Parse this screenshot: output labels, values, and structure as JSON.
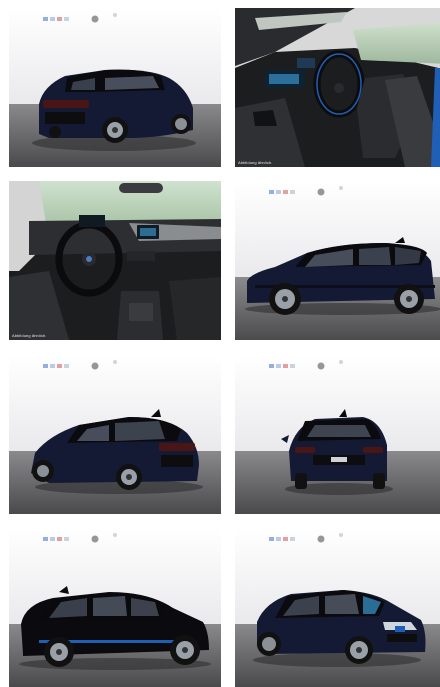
{
  "gallery": {
    "tiles": [
      {
        "kind": "exterior",
        "view": "rear-left-three-quarter",
        "caption": ""
      },
      {
        "kind": "interior",
        "view": "driver-door-open",
        "caption": "Abbildung ähnlich."
      },
      {
        "kind": "interior",
        "view": "dashboard-cockpit",
        "caption": "Abbildung ähnlich."
      },
      {
        "kind": "exterior",
        "view": "side-profile-left",
        "caption": ""
      },
      {
        "kind": "exterior",
        "view": "rear-left-three-quarter",
        "caption": ""
      },
      {
        "kind": "exterior",
        "view": "rear",
        "caption": ""
      },
      {
        "kind": "exterior",
        "view": "side-profile-left",
        "caption": ""
      },
      {
        "kind": "exterior",
        "view": "front-left-three-quarter",
        "caption": ""
      }
    ]
  },
  "colors": {
    "studio_wall": "#f3f3f5",
    "studio_floor": "#555557",
    "car_body": "#141a33",
    "car_roof": "#0b0b0f",
    "interior_dark": "#1c1d1f",
    "accent_blue": "#1f5fb5"
  },
  "icons": [
    "brand-logo-icon",
    "camera-badge-icon",
    "photo-badge-icon"
  ]
}
